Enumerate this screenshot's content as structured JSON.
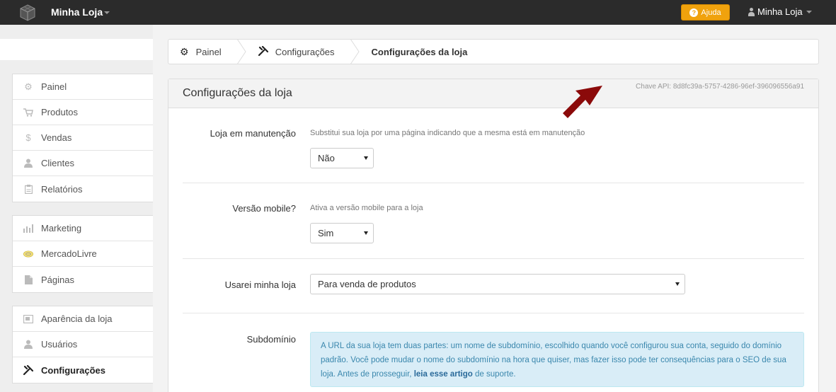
{
  "topbar": {
    "brand": "Minha Loja",
    "help_label": "Ajuda",
    "user_label": "Minha Loja"
  },
  "sidebar": {
    "groups": [
      [
        {
          "label": "Painel",
          "icon": "gear-icon"
        },
        {
          "label": "Produtos",
          "icon": "cart-icon"
        },
        {
          "label": "Vendas",
          "icon": "dollar-icon"
        },
        {
          "label": "Clientes",
          "icon": "user-icon"
        },
        {
          "label": "Relatórios",
          "icon": "clipboard-icon"
        }
      ],
      [
        {
          "label": "Marketing",
          "icon": "bar-chart-icon"
        },
        {
          "label": "MercadoLivre",
          "icon": "mercadolivre-icon"
        },
        {
          "label": "Páginas",
          "icon": "page-icon"
        }
      ],
      [
        {
          "label": "Aparência da loja",
          "icon": "picture-icon"
        },
        {
          "label": "Usuários",
          "icon": "user-icon"
        },
        {
          "label": "Configurações",
          "icon": "wrench-icon",
          "active": true
        }
      ]
    ]
  },
  "breadcrumb": {
    "items": [
      {
        "label": "Painel",
        "icon": "gear-icon"
      },
      {
        "label": "Configurações",
        "icon": "wrench-icon"
      },
      {
        "label": "Configurações da loja"
      }
    ]
  },
  "panel": {
    "title": "Configurações da loja",
    "api_key": "Chave API: 8d8fc39a-5757-4286-96ef-396096556a91"
  },
  "form": {
    "maintenance": {
      "label": "Loja em manutenção",
      "help": "Substitui sua loja por uma página indicando que a mesma está em manutenção",
      "value": "Não"
    },
    "mobile": {
      "label": "Versão mobile?",
      "help": "Ativa a versão mobile para a loja",
      "value": "Sim"
    },
    "usage": {
      "label": "Usarei minha loja",
      "value": "Para venda de produtos"
    },
    "subdomain": {
      "label": "Subdomínio",
      "info_pre": "A URL da sua loja tem duas partes: um nome de subdomínio, escolhido quando você configurou sua conta, seguido do domínio padrão. Você pode mudar o nome do subdomínio na hora que quiser, mas fazer isso pode ter consequências para o SEO de sua loja. Antes de prosseguir, ",
      "info_link": "leia esse artigo",
      "info_post": " de suporte."
    }
  },
  "colors": {
    "topbar": "#2b2b2b",
    "help_button": "#f0a20d",
    "info_bg": "#d9edf7",
    "annotation_arrow": "#8b0a0a"
  }
}
